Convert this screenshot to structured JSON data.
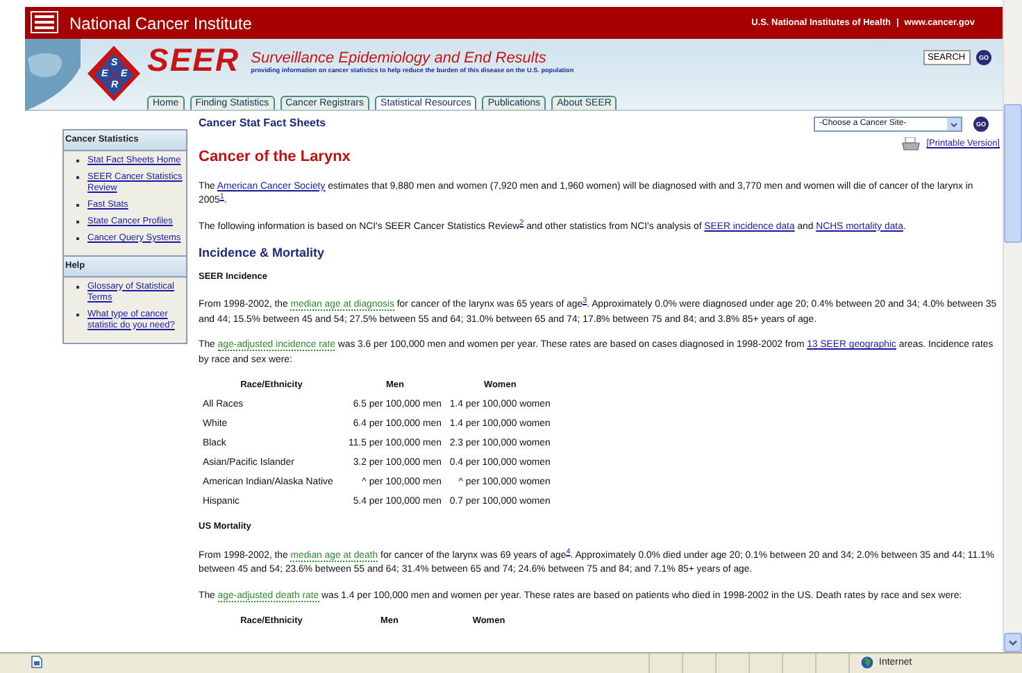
{
  "header": {
    "agency": "National Cancer Institute",
    "links": [
      "U.S. National Institutes of Health",
      "www.cancer.gov"
    ],
    "separator": "|"
  },
  "banner": {
    "logo": "SEER",
    "diamond_letters": [
      "S",
      "E",
      "E",
      "R"
    ],
    "title": "Surveillance Epidemiology and End Results",
    "tagline": "providing information on cancer statistics to help reduce the burden of this disease on the U.S. population",
    "search_value": "SEARCH",
    "go_label": "GO"
  },
  "tabs": [
    {
      "label": "Home",
      "selected": false
    },
    {
      "label": "Finding Statistics",
      "selected": false
    },
    {
      "label": "Cancer Registrars",
      "selected": false
    },
    {
      "label": "Statistical Resources",
      "selected": true
    },
    {
      "label": "Publications",
      "selected": false
    },
    {
      "label": "About SEER",
      "selected": false
    }
  ],
  "sidebar": [
    {
      "title": "Cancer Statistics",
      "items": [
        "Stat Fact Sheets Home",
        "SEER Cancer Statistics Review",
        "Fast Stats",
        "State Cancer Profiles",
        "Cancer Query Systems"
      ]
    },
    {
      "title": "Help",
      "items": [
        "Glossary of Statistical Terms",
        "What type of cancer statistic do you need?"
      ]
    }
  ],
  "main": {
    "section_title": "Cancer Stat Fact Sheets",
    "site_select": {
      "value": "-Choose a Cancer Site-"
    },
    "go_label": "GO",
    "printable": "[Printable Version]",
    "page_title": "Cancer of the Larynx",
    "blocks": [
      {
        "kind": "paragraph",
        "segments": [
          {
            "kind": "text",
            "text": "The "
          },
          {
            "kind": "link",
            "text": "American Cancer Society"
          },
          {
            "kind": "text",
            "text": " estimates that 9,880 men and women (7,920 men and 1,960 women) will be diagnosed with and 3,770 men and women will die of cancer of the larynx in 2005"
          },
          {
            "kind": "note",
            "text": "1"
          },
          {
            "kind": "text",
            "text": "."
          }
        ]
      },
      {
        "kind": "paragraph",
        "segments": [
          {
            "kind": "text",
            "text": "The following information is based on NCI's SEER Cancer Statistics Review"
          },
          {
            "kind": "note",
            "text": "2"
          },
          {
            "kind": "text",
            "text": " and other statistics from NCI's analysis of "
          },
          {
            "kind": "link",
            "text": "SEER incidence data"
          },
          {
            "kind": "text",
            "text": " and "
          },
          {
            "kind": "link",
            "text": "NCHS mortality data"
          },
          {
            "kind": "text",
            "text": "."
          }
        ]
      },
      {
        "kind": "heading",
        "text": "Incidence & Mortality"
      },
      {
        "kind": "subheading",
        "text": "SEER Incidence"
      },
      {
        "kind": "paragraph",
        "segments": [
          {
            "kind": "text",
            "text": "From 1998-2002, the "
          },
          {
            "kind": "term",
            "text": "median age at diagnosis"
          },
          {
            "kind": "text",
            "text": " for cancer of the larynx was 65 years of age"
          },
          {
            "kind": "note",
            "text": "3"
          },
          {
            "kind": "text",
            "text": ". Approximately 0.0% were diagnosed under age 20; 0.4% between 20 and 34; 4.0% between 35 and 44; 15.5% between 45 and 54; 27.5% between 55 and 64; 31.0% between 65 and 74; 17.8% between 75 and 84; and 3.8% 85+ years of age."
          }
        ]
      },
      {
        "kind": "paragraph",
        "segments": [
          {
            "kind": "text",
            "text": "The "
          },
          {
            "kind": "term",
            "text": "age-adjusted incidence rate"
          },
          {
            "kind": "text",
            "text": " was 3.6 per 100,000 men and women per year. These rates are based on cases diagnosed in 1998-2002 from "
          },
          {
            "kind": "link",
            "text": "13 SEER geographic"
          },
          {
            "kind": "text",
            "text": " areas. Incidence rates by race and sex were:"
          }
        ]
      },
      {
        "kind": "table",
        "columns": [
          "Race/Ethnicity",
          "Men",
          "Women"
        ],
        "rows": [
          [
            "All Races",
            "6.5 per 100,000 men",
            "1.4 per 100,000 women"
          ],
          [
            "White",
            "6.4 per 100,000 men",
            "1.4 per 100,000 women"
          ],
          [
            "Black",
            "11.5 per 100,000 men",
            "2.3 per 100,000 women"
          ],
          [
            "Asian/Pacific Islander",
            "3.2 per 100,000 men",
            "0.4 per 100,000 women"
          ],
          [
            "American Indian/Alaska Native",
            "^ per 100,000 men",
            "^ per 100,000 women"
          ],
          [
            "Hispanic",
            "5.4 per 100,000 men",
            "0.7 per 100,000 women"
          ]
        ]
      },
      {
        "kind": "subheading",
        "text": "US Mortality"
      },
      {
        "kind": "paragraph",
        "segments": [
          {
            "kind": "text",
            "text": "From 1998-2002, the "
          },
          {
            "kind": "term",
            "text": "median age at death"
          },
          {
            "kind": "text",
            "text": " for cancer of the larynx was 69 years of age"
          },
          {
            "kind": "note",
            "text": "4"
          },
          {
            "kind": "text",
            "text": ". Approximately 0.0% died under age 20; 0.1% between 20 and 34; 2.0% between 35 and 44; 11.1% between 45 and 54; 23.6% between 55 and 64; 31.4% between 65 and 74; 24.6% between 75 and 84; and 7.1% 85+ years of age."
          }
        ]
      },
      {
        "kind": "paragraph",
        "segments": [
          {
            "kind": "text",
            "text": "The "
          },
          {
            "kind": "term",
            "text": "age-adjusted death rate"
          },
          {
            "kind": "text",
            "text": " was 1.4 per 100,000 men and women per year. These rates are based on patients who died in 1998-2002 in the US. Death rates by race and sex were:"
          }
        ]
      },
      {
        "kind": "table",
        "columns": [
          "Race/Ethnicity",
          "Men",
          "Women"
        ]
      }
    ]
  },
  "status_bar": {
    "zone": "Internet"
  }
}
